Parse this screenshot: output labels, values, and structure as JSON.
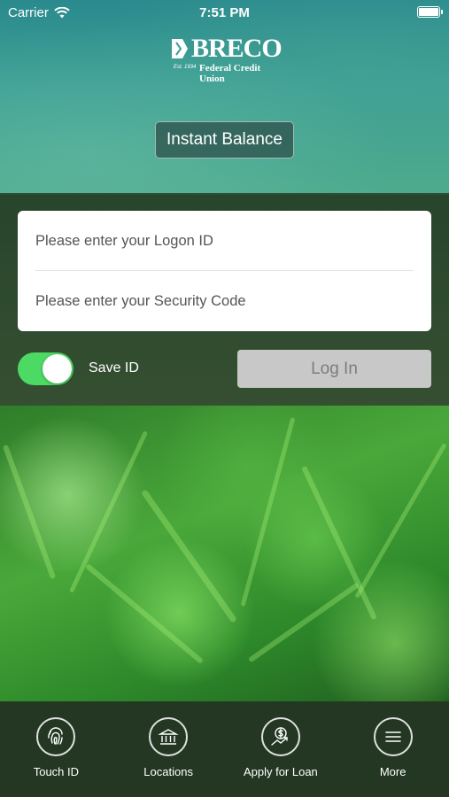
{
  "status_bar": {
    "carrier": "Carrier",
    "time": "7:51 PM"
  },
  "logo": {
    "name": "BRECO",
    "established": "Est. 1934",
    "subtitle": "Federal Credit Union"
  },
  "instant_balance": {
    "label": "Instant Balance"
  },
  "login_form": {
    "logon_placeholder": "Please enter your Logon ID",
    "security_placeholder": "Please enter your Security Code"
  },
  "save_id": {
    "label": "Save ID",
    "enabled": true
  },
  "login_button": {
    "label": "Log In"
  },
  "bottom_nav": {
    "touch_id": {
      "label": "Touch ID",
      "icon": "fingerprint-icon"
    },
    "locations": {
      "label": "Locations",
      "icon": "bank-icon"
    },
    "apply_loan": {
      "label": "Apply for Loan",
      "icon": "dollar-growth-icon"
    },
    "more": {
      "label": "More",
      "icon": "hamburger-icon"
    }
  },
  "colors": {
    "toggle_on": "#4cd964",
    "login_button_bg": "#c8c8c8",
    "login_button_text": "#7d7d7d"
  }
}
